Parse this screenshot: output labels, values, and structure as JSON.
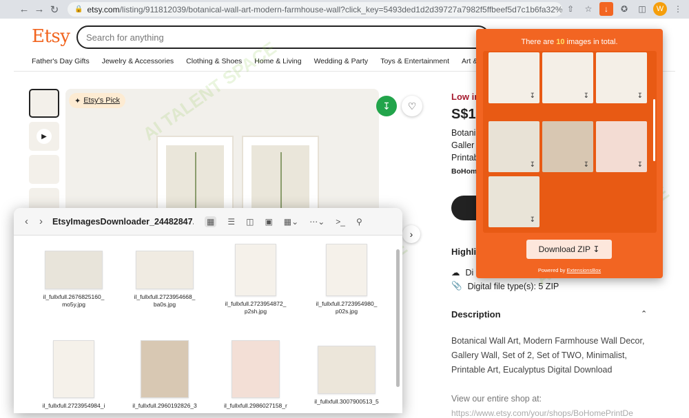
{
  "browser": {
    "url_host": "etsy.com",
    "url_path": "/listing/911812039/botanical-wall-art-modern-farmhouse-wall?click_key=5493ded1d2d39727a7982f5ffbeef5d7c1b6fa32%3...",
    "profile_initial": "W"
  },
  "header": {
    "logo": "Etsy",
    "search_placeholder": "Search for anything"
  },
  "categories": [
    "Father's Day Gifts",
    "Jewelry & Accessories",
    "Clothing & Shoes",
    "Home & Living",
    "Wedding & Party",
    "Toys & Entertainment",
    "Art &"
  ],
  "listing": {
    "badge": "Etsy's Pick",
    "low_stock": "Low in",
    "price": "S$1",
    "title_lines": [
      "Botani",
      "Galler",
      "Printab"
    ],
    "shop": "BoHome",
    "highlights_title": "Highlig",
    "highlight_download": "Di",
    "highlight_filetype": "Digital file type(s): 5 ZIP",
    "description_title": "Description",
    "description_body": "Botanical Wall Art, Modern Farmhouse Wall Decor, Gallery Wall, Set of 2, Set of TWO, Minimalist, Printable Art, Eucalyptus Digital Download",
    "shop_link_text": "View our entire shop at:",
    "shop_url": "https://www.etsy.com/your/shops/BoHomePrintDe"
  },
  "popup": {
    "header_prefix": "There are",
    "count": "10",
    "header_suffix": "images in total.",
    "button": "Download ZIP",
    "powered_prefix": "Powered by",
    "powered_link": "ExtensionsBox"
  },
  "finder": {
    "title": "EtsyImagesDownloader_24482847...",
    "files": [
      {
        "line1": "il_fullxfull.2676825160_",
        "line2": "mo5y.jpg"
      },
      {
        "line1": "il_fullxfull.2723954668_",
        "line2": "ba0s.jpg"
      },
      {
        "line1": "il_fullxfull.2723954872_",
        "line2": "p2sh.jpg"
      },
      {
        "line1": "il_fullxfull.2723954980_",
        "line2": "p02s.jpg"
      },
      {
        "line1": "il_fullxfull.2723954984_i",
        "line2": ""
      },
      {
        "line1": "il_fullxfull.2960192826_3",
        "line2": ""
      },
      {
        "line1": "il_fullxfull.2986027158_r",
        "line2": ""
      },
      {
        "line1": "il_fullxfull.3007900513_5",
        "line2": ""
      }
    ]
  },
  "colors": {
    "etsy_orange": "#f1641e",
    "popup_orange": "#f26522",
    "download_green": "#22a44b"
  }
}
